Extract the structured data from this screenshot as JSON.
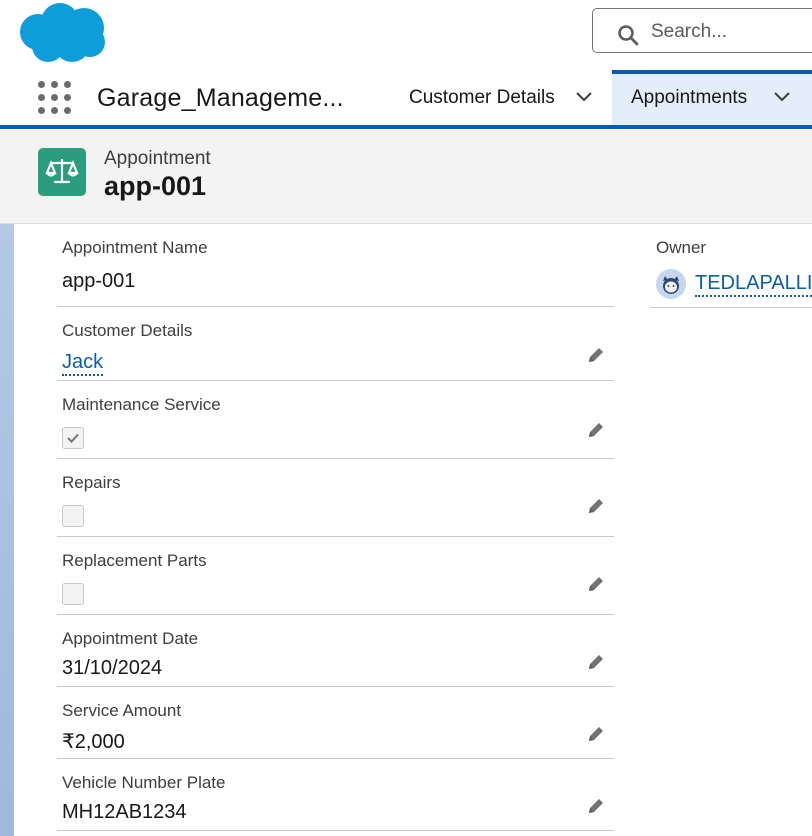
{
  "header": {
    "search_placeholder": "Search...",
    "logo_icon": "salesforce-cloud-logo",
    "brand_color": "#1798c1"
  },
  "nav": {
    "app_name": "Garage_Manageme...",
    "tabs": [
      {
        "label": "Customer Details",
        "active": false
      },
      {
        "label": "Appointments",
        "active": true
      }
    ],
    "accent_color": "#0b5cab"
  },
  "record": {
    "object_type": "Appointment",
    "title": "app-001",
    "icon": "scales-icon",
    "icon_color": "#2a9d7c"
  },
  "fields": {
    "appointment_name": {
      "label": "Appointment Name",
      "value": "app-001"
    },
    "customer_details": {
      "label": "Customer Details",
      "value": "Jack"
    },
    "maintenance_service": {
      "label": "Maintenance Service",
      "checked": true
    },
    "repairs": {
      "label": "Repairs",
      "checked": false
    },
    "replacement_parts": {
      "label": "Replacement Parts",
      "checked": false
    },
    "appointment_date": {
      "label": "Appointment Date",
      "value": "31/10/2024"
    },
    "service_amount": {
      "label": "Service Amount",
      "value": "₹2,000"
    },
    "vehicle_number_plate": {
      "label": "Vehicle Number Plate",
      "value": "MH12AB1234"
    }
  },
  "owner": {
    "label": "Owner",
    "name": "TEDLAPALLI"
  }
}
